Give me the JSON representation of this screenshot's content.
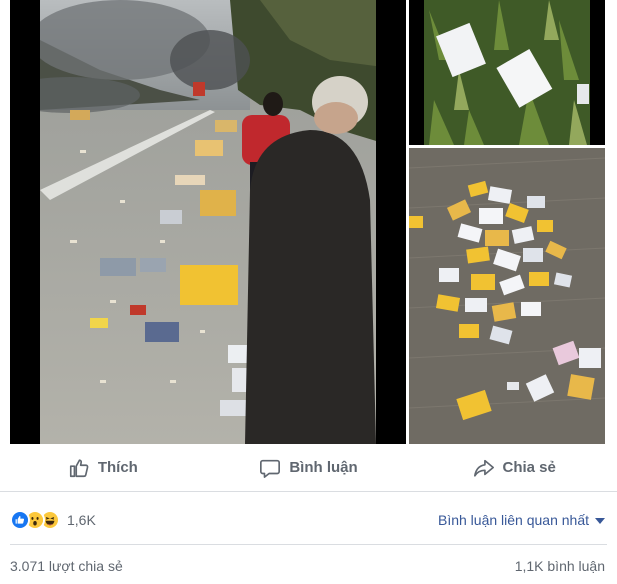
{
  "actions": {
    "like_label": "Thích",
    "comment_label": "Bình luận",
    "share_label": "Chia sẻ"
  },
  "reactions": {
    "icons": [
      "like-icon",
      "wow-icon",
      "haha-icon"
    ],
    "count": "1,6K"
  },
  "comment_sort": {
    "label": "Bình luận liên quan nhất"
  },
  "stats": {
    "shares": "3.071 lượt chia sẻ",
    "comments": "1,1K bình luận"
  },
  "colors": {
    "action_text": "#606770",
    "link_blue": "#385898",
    "like_blue": "#1877f2",
    "emoji_yellow": "#fcc83c",
    "divider": "#dadde1"
  }
}
